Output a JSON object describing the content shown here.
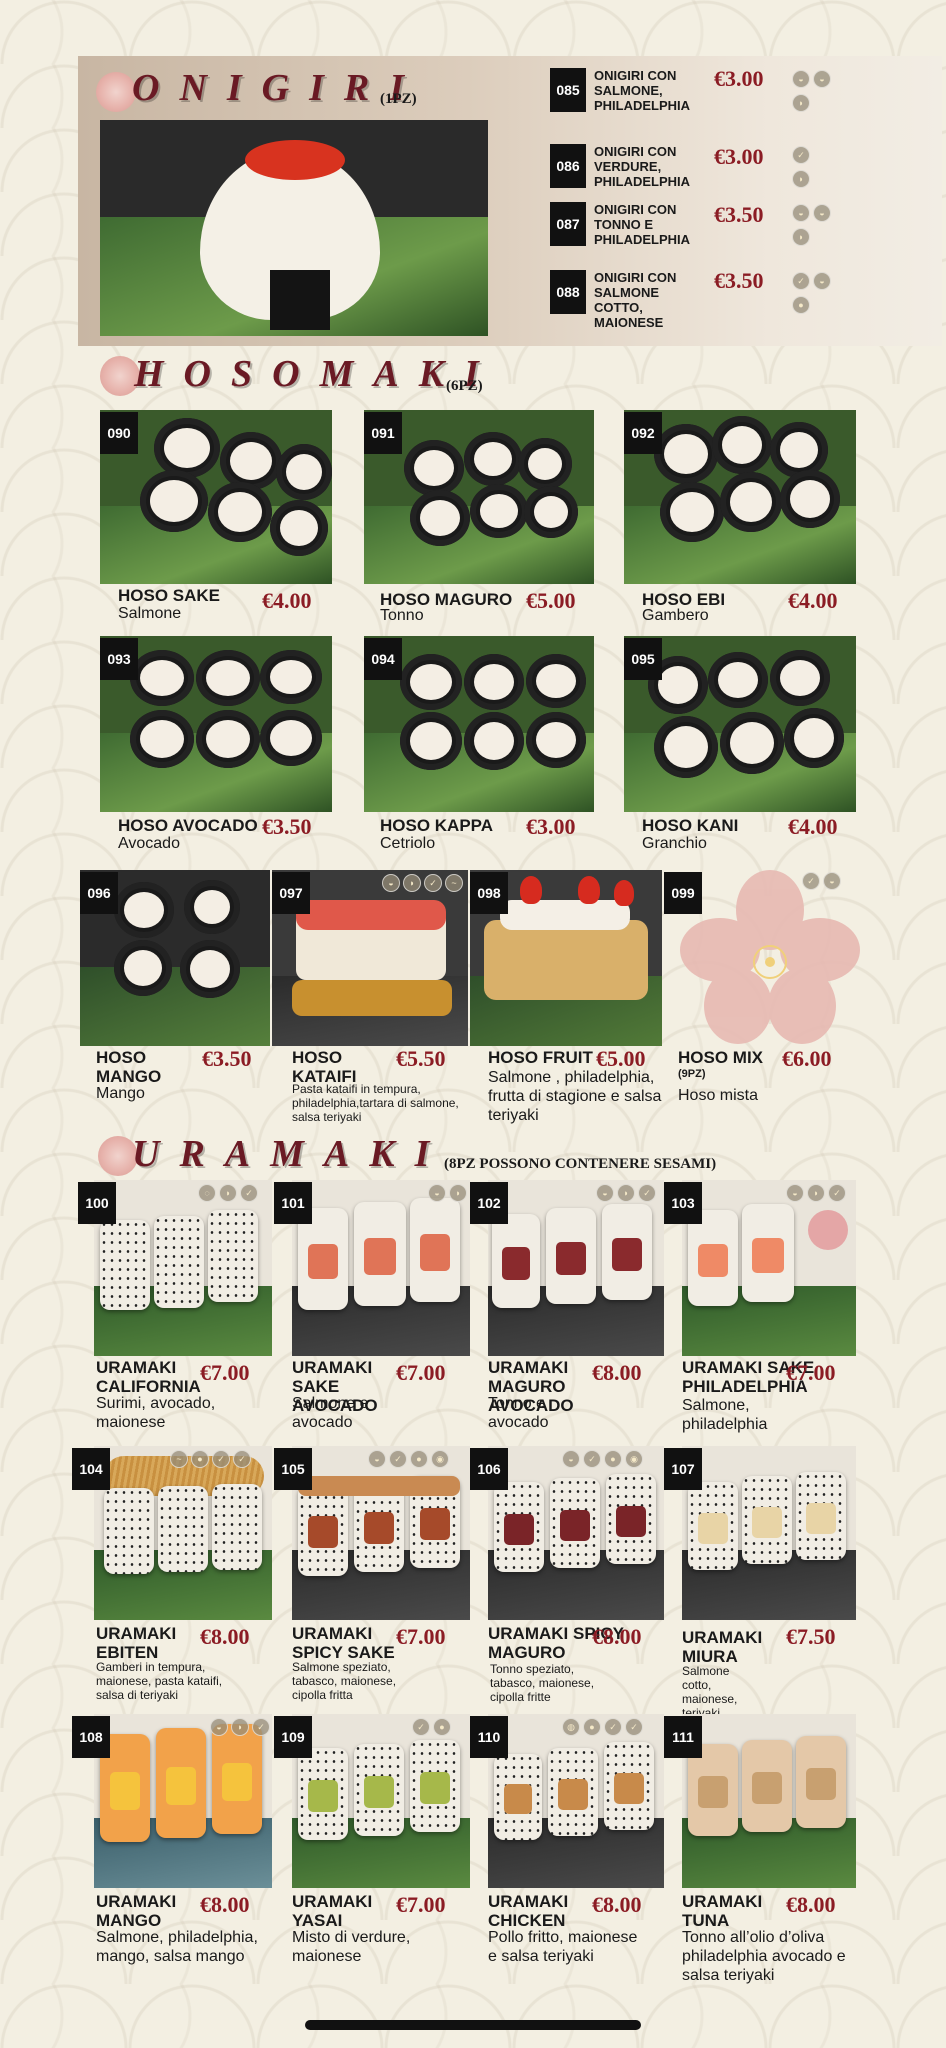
{
  "sections": {
    "onigiri": {
      "title": "ONIGIRI",
      "pcs": "(1PZ)"
    },
    "hosomaki": {
      "title": "HOSOMAKI",
      "pcs": "(6PZ)"
    },
    "uramaki": {
      "title": "URAMAKI",
      "pcs": "(8PZ POSSONO CONTENERE SESAMI)"
    }
  },
  "onigiri_items": [
    {
      "num": "085",
      "name": "ONIGIRI CON SALMONE, PHILADELPHIA",
      "price": "€3.00"
    },
    {
      "num": "086",
      "name": "ONIGIRI CON VERDURE, PHILADELPHIA",
      "price": "€3.00"
    },
    {
      "num": "087",
      "name": "ONIGIRI CON TONNO E PHILADELPHIA",
      "price": "€3.50"
    },
    {
      "num": "088",
      "name": "ONIGIRI CON SALMONE COTTO, MAIONESE",
      "price": "€3.50"
    }
  ],
  "hoso_items": [
    {
      "num": "090",
      "name": "HOSO SAKE",
      "sub": "Salmone",
      "price": "€4.00"
    },
    {
      "num": "091",
      "name": "HOSO MAGURO",
      "sub": "Tonno",
      "price": "€5.00"
    },
    {
      "num": "092",
      "name": "HOSO EBI",
      "sub": "Gambero",
      "price": "€4.00"
    },
    {
      "num": "093",
      "name": "HOSO AVOCADO",
      "sub": "Avocado",
      "price": "€3.50"
    },
    {
      "num": "094",
      "name": "HOSO KAPPA",
      "sub": "Cetriolo",
      "price": "€3.00"
    },
    {
      "num": "095",
      "name": "HOSO KANI",
      "sub": "Granchio",
      "price": "€4.00"
    }
  ],
  "hoso_row3": [
    {
      "num": "096",
      "name": "HOSO MANGO",
      "sub": "Mango",
      "price": "€3.50"
    },
    {
      "num": "097",
      "name": "HOSO KATAIFI",
      "sub": "Pasta kataifi in tempura, philadelphia,tartara di salmone, salsa teriyaki",
      "price": "€5.50"
    },
    {
      "num": "098",
      "name": "HOSO FRUIT",
      "sub": "Salmone , philadelphia, frutta di stagione e salsa teriyaki",
      "price": "€5.00"
    },
    {
      "num": "099",
      "name": "HOSO MIX",
      "pz": "(9PZ)",
      "sub": "Hoso mista",
      "price": "€6.00"
    }
  ],
  "ura_items": [
    {
      "num": "100",
      "name": "URAMAKI CALIFORNIA",
      "sub": "Surimi, avocado, maionese",
      "price": "€7.00"
    },
    {
      "num": "101",
      "name": "URAMAKI SAKE AVOCADO",
      "sub": "Salmone e avocado",
      "price": "€7.00"
    },
    {
      "num": "102",
      "name": "URAMAKI MAGURO AVOCADO",
      "sub": "Tonno e avocado",
      "price": "€8.00"
    },
    {
      "num": "103",
      "name": "URAMAKI SAKE PHILADELPHIA",
      "sub": "Salmone, philadelphia",
      "price": "€7.00"
    },
    {
      "num": "104",
      "name": "URAMAKI EBITEN",
      "sub": "Gamberi in tempura, maionese, pasta kataifi, salsa di teriyaki",
      "price": "€8.00"
    },
    {
      "num": "105",
      "name": "URAMAKI SPICY SAKE",
      "sub": "Salmone speziato, tabasco, maionese, cipolla fritta",
      "price": "€7.00"
    },
    {
      "num": "106",
      "name": "URAMAKI SPICY MAGURO",
      "sub": "Tonno speziato, tabasco, maionese, cipolla fritte",
      "price": "€8.00"
    },
    {
      "num": "107",
      "name": "URAMAKI MIURA",
      "sub": "Salmone cotto, maionese, teriyaki",
      "price": "€7.50"
    },
    {
      "num": "108",
      "name": "URAMAKI MANGO",
      "sub": "Salmone, philadelphia, mango, salsa mango",
      "price": "€8.00"
    },
    {
      "num": "109",
      "name": "URAMAKI YASAI",
      "sub": "Misto di verdure, maionese",
      "price": "€7.00"
    },
    {
      "num": "110",
      "name": "URAMAKI CHICKEN",
      "sub": "Pollo fritto, maionese e salsa teriyaki",
      "price": "€8.00"
    },
    {
      "num": "111",
      "name": "URAMAKI TUNA",
      "sub": "Tonno all’olio d’oliva philadelphia avocado e salsa teriyaki",
      "price": "€8.00"
    }
  ],
  "colors": {
    "price": "#8b1c24",
    "title": "#6a1a24",
    "background": "#f3efe2"
  }
}
